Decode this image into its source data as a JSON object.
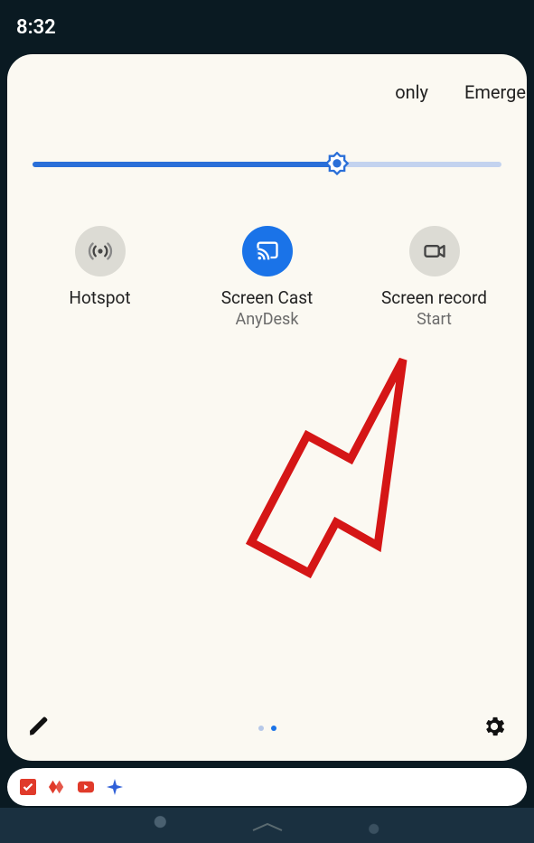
{
  "status": {
    "time": "8:32"
  },
  "panel": {
    "top_text": {
      "only": "only",
      "emergency": "Emergen"
    },
    "brightness": {
      "percent": 65
    },
    "tiles": [
      {
        "label": "Hotspot",
        "sub": "",
        "active": false,
        "icon": "hotspot"
      },
      {
        "label": "Screen Cast",
        "sub": "AnyDesk",
        "active": true,
        "icon": "cast"
      },
      {
        "label": "Screen record",
        "sub": "Start",
        "active": false,
        "icon": "record"
      }
    ],
    "page": {
      "current": 2,
      "total": 2
    }
  },
  "notification_icons": [
    "todo",
    "anydesk",
    "youtube",
    "sparkle"
  ],
  "colors": {
    "accent": "#1a73e8",
    "panel_bg": "#fbf9f2",
    "annotation": "#d51616"
  }
}
